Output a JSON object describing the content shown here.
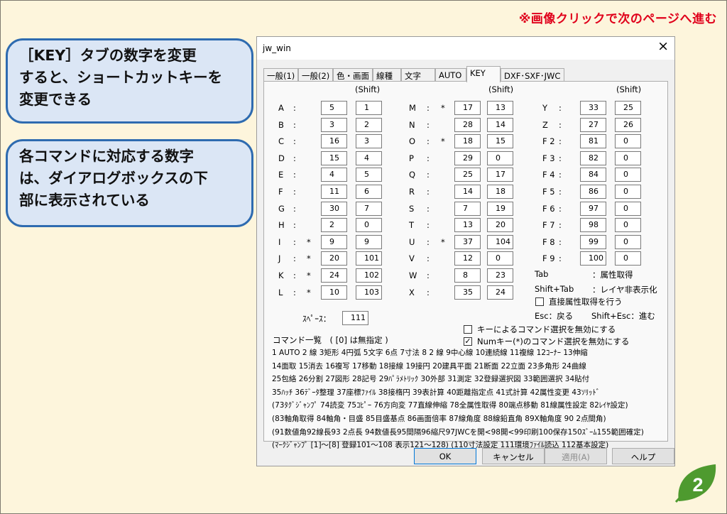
{
  "slide": {
    "top_note": "※画像クリックで次のページへ進む",
    "callout1": [
      "［KEY］タブの数字を変更",
      "すると、ショートカットキーを",
      "変更できる"
    ],
    "callout2": [
      "各コマンドに対応する数字",
      "は、ダイアログボックスの下",
      "部に表示されている"
    ],
    "page_number": "2",
    "colors": {
      "background": "#fdf5dc",
      "note_red": "#e0001b",
      "callout_fill": "#dbe6f5",
      "callout_border": "#2e6bb0",
      "leaf_green": "#4e9a2f"
    }
  },
  "dialog": {
    "title": "jw_win",
    "close_icon": "×",
    "tabs": [
      "一般(1)",
      "一般(2)",
      "色・画面",
      "線種",
      "文字",
      "AUTO",
      "KEY",
      "DXF･SXF･JWC"
    ],
    "active_tab": "KEY",
    "shift_header": "(Shift)",
    "column1": [
      {
        "key": "A",
        "star": "",
        "v": "5",
        "s": "1"
      },
      {
        "key": "B",
        "star": "",
        "v": "3",
        "s": "2"
      },
      {
        "key": "C",
        "star": "",
        "v": "16",
        "s": "3"
      },
      {
        "key": "D",
        "star": "",
        "v": "15",
        "s": "4"
      },
      {
        "key": "E",
        "star": "",
        "v": "4",
        "s": "5"
      },
      {
        "key": "F",
        "star": "",
        "v": "11",
        "s": "6"
      },
      {
        "key": "G",
        "star": "",
        "v": "30",
        "s": "7"
      },
      {
        "key": "H",
        "star": "",
        "v": "2",
        "s": "0"
      },
      {
        "key": "I",
        "star": "*",
        "v": "9",
        "s": "9"
      },
      {
        "key": "J",
        "star": "*",
        "v": "20",
        "s": "101"
      },
      {
        "key": "K",
        "star": "*",
        "v": "24",
        "s": "102"
      },
      {
        "key": "L",
        "star": "*",
        "v": "10",
        "s": "103"
      }
    ],
    "column2": [
      {
        "key": "M",
        "star": "*",
        "v": "17",
        "s": "13"
      },
      {
        "key": "N",
        "star": "",
        "v": "28",
        "s": "14"
      },
      {
        "key": "O",
        "star": "*",
        "v": "18",
        "s": "15"
      },
      {
        "key": "P",
        "star": "",
        "v": "29",
        "s": "0"
      },
      {
        "key": "Q",
        "star": "",
        "v": "25",
        "s": "17"
      },
      {
        "key": "R",
        "star": "",
        "v": "14",
        "s": "18"
      },
      {
        "key": "S",
        "star": "",
        "v": "7",
        "s": "19"
      },
      {
        "key": "T",
        "star": "",
        "v": "13",
        "s": "20"
      },
      {
        "key": "U",
        "star": "*",
        "v": "37",
        "s": "104"
      },
      {
        "key": "V",
        "star": "",
        "v": "12",
        "s": "0"
      },
      {
        "key": "W",
        "star": "",
        "v": "8",
        "s": "23"
      },
      {
        "key": "X",
        "star": "",
        "v": "35",
        "s": "24"
      }
    ],
    "column3": [
      {
        "key": "Y",
        "v": "33",
        "s": "25"
      },
      {
        "key": "Z",
        "v": "27",
        "s": "26"
      },
      {
        "key": "F 2",
        "v": "81",
        "s": "0"
      },
      {
        "key": "F 3",
        "v": "82",
        "s": "0"
      },
      {
        "key": "F 4",
        "v": "84",
        "s": "0"
      },
      {
        "key": "F 5",
        "v": "86",
        "s": "0"
      },
      {
        "key": "F 6",
        "v": "97",
        "s": "0"
      },
      {
        "key": "F 7",
        "v": "98",
        "s": "0"
      },
      {
        "key": "F 8",
        "v": "99",
        "s": "0"
      },
      {
        "key": "F 9",
        "v": "100",
        "s": "0"
      }
    ],
    "tab_info": [
      {
        "k": "Tab",
        "v": "：属性取得"
      },
      {
        "k": "Shift+Tab",
        "v": "：レイヤ非表示化"
      }
    ],
    "direct_attr_label": "直接属性取得を行う",
    "esc_label": "Esc：戻る",
    "shift_esc_label": "Shift+Esc：進む",
    "space_label": "ｽﾍﾟｰｽ：",
    "space_value": "111",
    "disable_key_cmd_label": "キーによるコマンド選択を無効にする",
    "num_key_label": "Numキー(*)のコマンド選択を無効にする",
    "num_key_checked": "✓",
    "command_list_title": "コマンド一覧　( [0] は無指定 )",
    "command_lines": [
      "1 AUTO  2 線  3矩形  4円弧  5文字  6点  7寸法  8 2 線  9中心線  10連続線  11複線  12ｺｰﾅｰ  13伸縮",
      "14面取  15消去  16複写  17移動  18接線  19接円  20建具平面  21断面  22立面  23多角形  24曲線",
      "25包絡  26分割  27図形  28記号  29ﾊﾟﾗﾒﾄﾘｯｸ  30外部  31測定  32登録選択図  33範囲選択  34貼付",
      "35ﾊｯﾁ  36ﾃﾞｰﾀ整理  37座標ﾌｧｲﾙ  38接楕円  39表計算  40距離指定点  41式計算  42属性変更  43ｿﾘｯﾄﾞ",
      "(73ﾀｸﾞｼﾞｬﾝﾌﾟ  74読変  75ｺﾋﾟｰ  76方向変  77直線伸縮  78全属性取得  80端点移動  81線属性設定  82ﾚｲﾔ設定)",
      "(83軸角取得  84軸角・目盛  85目盛基点  86画面倍率  87線角度  88線鉛直角  89X軸角度  90 2点間角)",
      "(91数値角92線長93 2点長  94数値長95間隔96縮尺97JWCを開<98開<99印刷100保存150ｽﾞｰﾑ155範囲確定)",
      "(ﾏｰｸｼﾞｬﾝﾌﾟ [1]～[8] 登録101～108 表示121～128)  (110寸法設定  111環境ﾌｧｲﾙ読込  112基本設定)"
    ],
    "buttons": {
      "ok": "OK",
      "cancel": "キャンセル",
      "apply": "適用(A)",
      "help": "ヘルプ"
    }
  }
}
